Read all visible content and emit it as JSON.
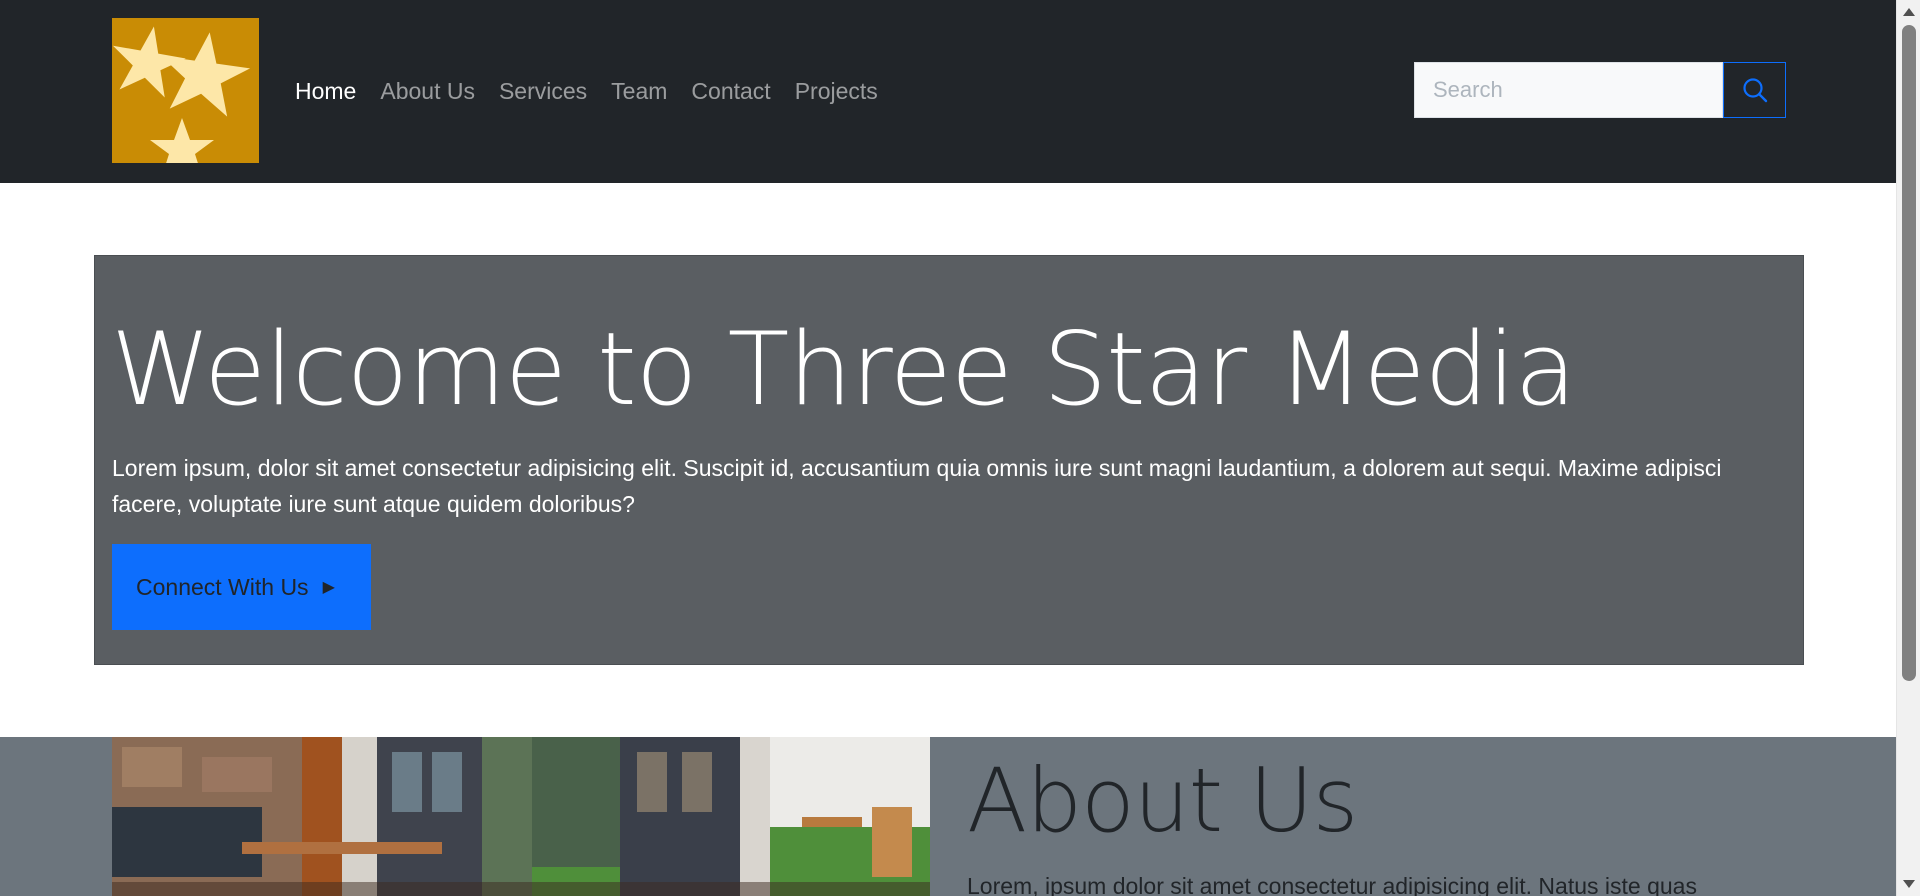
{
  "nav": {
    "logo_alt": "Three Star Media logo",
    "links": [
      "Home",
      "About Us",
      "Services",
      "Team",
      "Contact",
      "Projects"
    ],
    "active": "Home",
    "search_placeholder": "Search"
  },
  "hero": {
    "title": "Welcome to Three Star Media",
    "text": "Lorem ipsum, dolor sit amet consectetur adipisicing elit. Suscipit id, accusantium quia omnis iure sunt magni laudantium, a dolorem aut sequi. Maxime adipisci facere, voluptate iure sunt atque quidem doloribus?",
    "button_label": "Connect With Us"
  },
  "about": {
    "title": "About Us",
    "text": "Lorem, ipsum dolor sit amet consectetur adipisicing elit. Natus iste quas"
  },
  "colors": {
    "navbar_bg": "#212529",
    "logo_bg": "#c98c05",
    "star": "#fde7a8",
    "hero_bg": "#5a5e62",
    "primary": "#0d6efd",
    "about_bg": "#6c757d"
  }
}
